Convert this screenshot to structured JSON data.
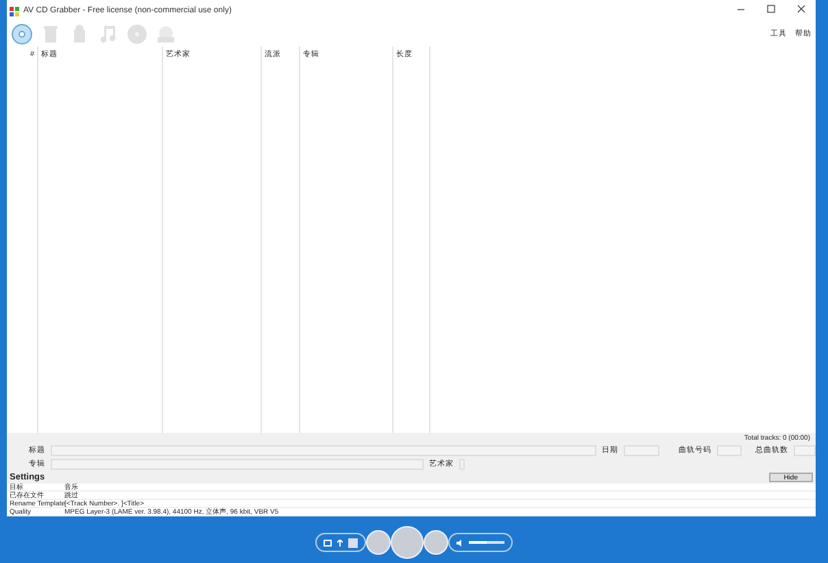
{
  "window": {
    "title": "AV CD Grabber - Free license (non-commercial use only)"
  },
  "toolbar": [
    {
      "kind": "cd",
      "disabled": false
    },
    {
      "kind": "trash",
      "disabled": true
    },
    {
      "kind": "trash-full",
      "disabled": true
    },
    {
      "kind": "music",
      "disabled": true
    },
    {
      "kind": "disc",
      "disabled": true
    },
    {
      "kind": "drive",
      "disabled": true
    }
  ],
  "menu": [
    "工具",
    "帮助"
  ],
  "table": {
    "columns": [
      "#",
      "标题",
      "艺术家",
      "流派",
      "专辑",
      "长度"
    ]
  },
  "total_tracks": "Total tracks: 0 (00:00)",
  "tags": {
    "title_label": "标题",
    "album_label": "专辑",
    "artist_label": "艺术家",
    "date_label": "日期",
    "track_label": "曲轨号码",
    "total_label": "总曲轨数"
  },
  "settings": {
    "heading": "Settings",
    "hide_button": "Hide",
    "rows": [
      {
        "label": "目标",
        "value": "音乐"
      },
      {
        "label": "已存在文件",
        "value": "跳过"
      },
      {
        "label": "Rename Template",
        "value": "[<Track Number>. ]<Title>"
      },
      {
        "label": "Quality",
        "value": "MPEG Layer-3 (LAME ver. 3.98.4), 44100 Hz, 立体声, 96 kbit, VBR V5"
      }
    ]
  },
  "player": {
    "volume": {
      "level": 0.5
    }
  }
}
